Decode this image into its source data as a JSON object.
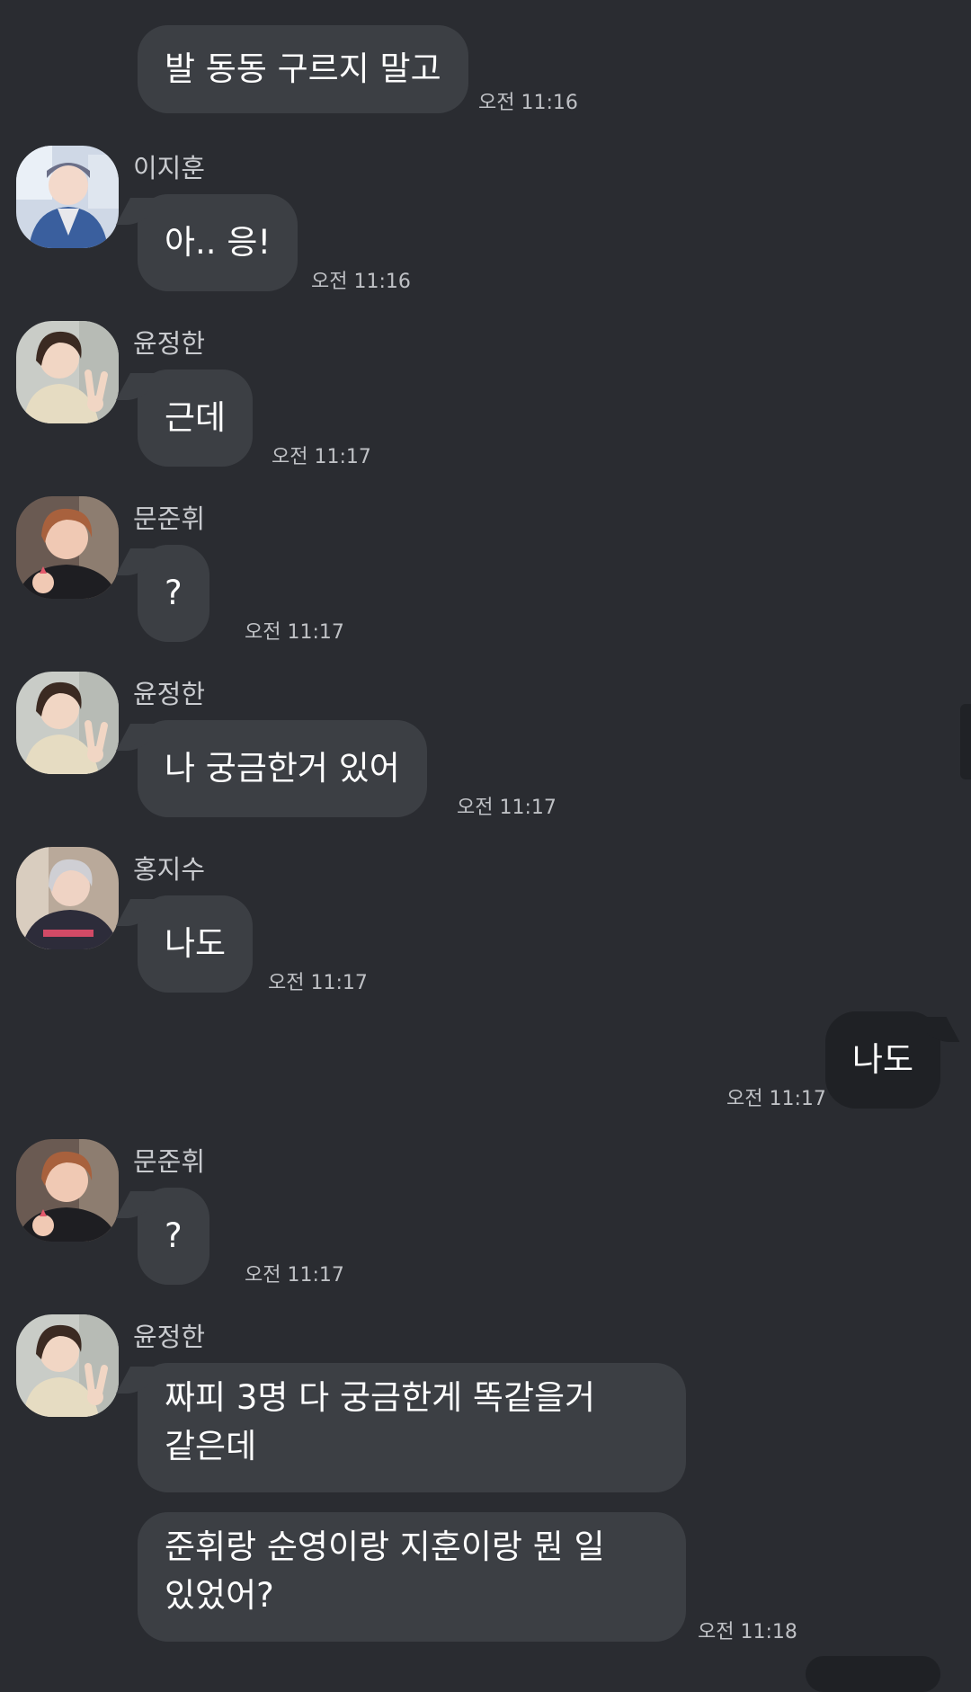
{
  "messages": [
    {
      "sender": "",
      "text": "발 동동 구르지 말고",
      "time": "오전 11:16"
    },
    {
      "sender": "이지훈",
      "avatar": "jihoon-avatar",
      "text": "아.. 응!",
      "time": "오전 11:16"
    },
    {
      "sender": "윤정한",
      "avatar": "jeonghan-avatar",
      "text": "근데",
      "time": "오전 11:17"
    },
    {
      "sender": "문준휘",
      "avatar": "junhui-avatar",
      "text": "?",
      "time": "오전 11:17"
    },
    {
      "sender": "윤정한",
      "avatar": "jeonghan-avatar",
      "text": "나 궁금한거 있어",
      "time": "오전 11:17"
    },
    {
      "sender": "홍지수",
      "avatar": "jisoo-avatar",
      "text": "나도",
      "time": "오전 11:17"
    },
    {
      "sender": "me",
      "text": "나도",
      "time": "오전 11:17"
    },
    {
      "sender": "문준휘",
      "avatar": "junhui-avatar",
      "text": "?",
      "time": "오전 11:17"
    },
    {
      "sender": "윤정한",
      "avatar": "jeonghan-avatar",
      "lines": [
        "짜피 3명 다 궁금한게 똑같을거",
        "같은데"
      ]
    },
    {
      "sender": "윤정한",
      "lines": [
        "준휘랑 순영이랑 지훈이랑 뭔 일",
        "있었어?"
      ],
      "time": "오전 11:18"
    }
  ],
  "colors": {
    "background": "#2a2c31",
    "incoming_bubble": "#3c3f44",
    "outgoing_bubble": "#1f2125",
    "name_text": "#c9cbcf",
    "time_text": "#bfc1c5"
  }
}
